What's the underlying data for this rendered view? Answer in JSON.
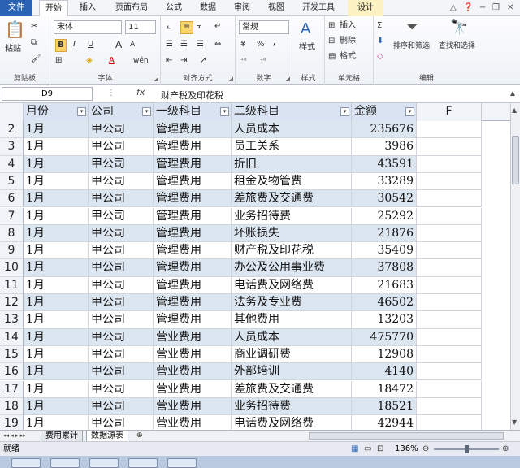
{
  "tabs": [
    "文件",
    "开始",
    "插入",
    "页面布局",
    "公式",
    "数据",
    "审阅",
    "视图",
    "开发工具",
    "设计"
  ],
  "ribbon": {
    "clipboard": {
      "label": "剪贴板",
      "paste": "粘贴"
    },
    "font": {
      "label": "字体",
      "name": "宋体",
      "size": "11",
      "bold": "B",
      "italic": "I",
      "underline": "U",
      "grow": "A",
      "shrink": "A",
      "color_a": "A",
      "wen": "wén"
    },
    "align": {
      "label": "对齐方式"
    },
    "number": {
      "label": "数字",
      "format": "常规",
      "percent": "%",
      "comma": ","
    },
    "style": {
      "label": "样式",
      "btn": "样式"
    },
    "cells": {
      "label": "单元格",
      "insert": "插入",
      "delete": "删除",
      "format": "格式"
    },
    "edit": {
      "label": "编辑",
      "sigma": "Σ",
      "sort": "排序和筛选",
      "find": "查找和选择"
    }
  },
  "formula_bar": {
    "name_box": "D9",
    "fx": "fx",
    "content": "财产税及印花税"
  },
  "headers": [
    "月份",
    "公司",
    "一级科目",
    "二级科目",
    "金额",
    "F"
  ],
  "rows": [
    {
      "n": "2",
      "m": "1月",
      "co": "甲公司",
      "l1": "管理费用",
      "l2": "人员成本",
      "amt": "235676"
    },
    {
      "n": "3",
      "m": "1月",
      "co": "甲公司",
      "l1": "管理费用",
      "l2": "员工关系",
      "amt": "3986"
    },
    {
      "n": "4",
      "m": "1月",
      "co": "甲公司",
      "l1": "管理费用",
      "l2": "折旧",
      "amt": "43591"
    },
    {
      "n": "5",
      "m": "1月",
      "co": "甲公司",
      "l1": "管理费用",
      "l2": "租金及物管费",
      "amt": "33289"
    },
    {
      "n": "6",
      "m": "1月",
      "co": "甲公司",
      "l1": "管理费用",
      "l2": "差旅费及交通费",
      "amt": "30542"
    },
    {
      "n": "7",
      "m": "1月",
      "co": "甲公司",
      "l1": "管理费用",
      "l2": "业务招待费",
      "amt": "25292"
    },
    {
      "n": "8",
      "m": "1月",
      "co": "甲公司",
      "l1": "管理费用",
      "l2": "坏账损失",
      "amt": "21876"
    },
    {
      "n": "9",
      "m": "1月",
      "co": "甲公司",
      "l1": "管理费用",
      "l2": "财产税及印花税",
      "amt": "35409"
    },
    {
      "n": "10",
      "m": "1月",
      "co": "甲公司",
      "l1": "管理费用",
      "l2": "办公及公用事业费",
      "amt": "37808"
    },
    {
      "n": "11",
      "m": "1月",
      "co": "甲公司",
      "l1": "管理费用",
      "l2": "电话费及网络费",
      "amt": "21683"
    },
    {
      "n": "12",
      "m": "1月",
      "co": "甲公司",
      "l1": "管理费用",
      "l2": "法务及专业费",
      "amt": "46502"
    },
    {
      "n": "13",
      "m": "1月",
      "co": "甲公司",
      "l1": "管理费用",
      "l2": "其他费用",
      "amt": "13203"
    },
    {
      "n": "14",
      "m": "1月",
      "co": "甲公司",
      "l1": "营业费用",
      "l2": "人员成本",
      "amt": "475770"
    },
    {
      "n": "15",
      "m": "1月",
      "co": "甲公司",
      "l1": "营业费用",
      "l2": "商业调研费",
      "amt": "12908"
    },
    {
      "n": "16",
      "m": "1月",
      "co": "甲公司",
      "l1": "营业费用",
      "l2": "外部培训",
      "amt": "4140"
    },
    {
      "n": "17",
      "m": "1月",
      "co": "甲公司",
      "l1": "营业费用",
      "l2": "差旅费及交通费",
      "amt": "18472"
    },
    {
      "n": "18",
      "m": "1月",
      "co": "甲公司",
      "l1": "营业费用",
      "l2": "业务招待费",
      "amt": "18521"
    },
    {
      "n": "19",
      "m": "1月",
      "co": "甲公司",
      "l1": "营业费用",
      "l2": "电话费及网络费",
      "amt": "42944"
    }
  ],
  "sheets": [
    "费用累计",
    "数据源表"
  ],
  "status": {
    "ready": "就绪",
    "zoom": "136%"
  }
}
